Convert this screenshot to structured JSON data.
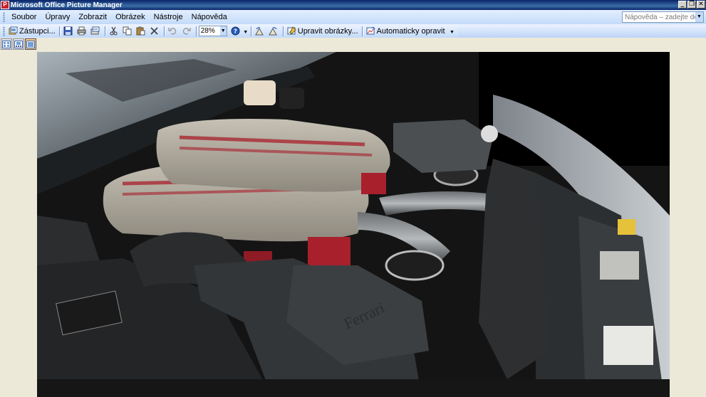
{
  "window": {
    "title": "Microsoft Office Picture Manager",
    "app_icon": "picture-manager-icon",
    "controls": {
      "minimize": "_",
      "maximize": "❐",
      "close": "✕"
    }
  },
  "menu": {
    "items": [
      {
        "label": "Soubor"
      },
      {
        "label": "Úpravy"
      },
      {
        "label": "Zobrazit"
      },
      {
        "label": "Obrázek"
      },
      {
        "label": "Nástroje"
      },
      {
        "label": "Nápověda"
      }
    ],
    "help_placeholder": "Nápověda – zadejte dotaz"
  },
  "toolbar": {
    "shortcuts_label": "Zástupci...",
    "zoom_value": "28%",
    "edit_pictures_label": "Upravit obrázky...",
    "auto_correct_label": "Automaticky opravit"
  },
  "colors": {
    "title_bar": "#0a246a",
    "menu_bar": "#c3daf9",
    "workspace": "#ece9d8",
    "engine_red": "#a8202c"
  }
}
